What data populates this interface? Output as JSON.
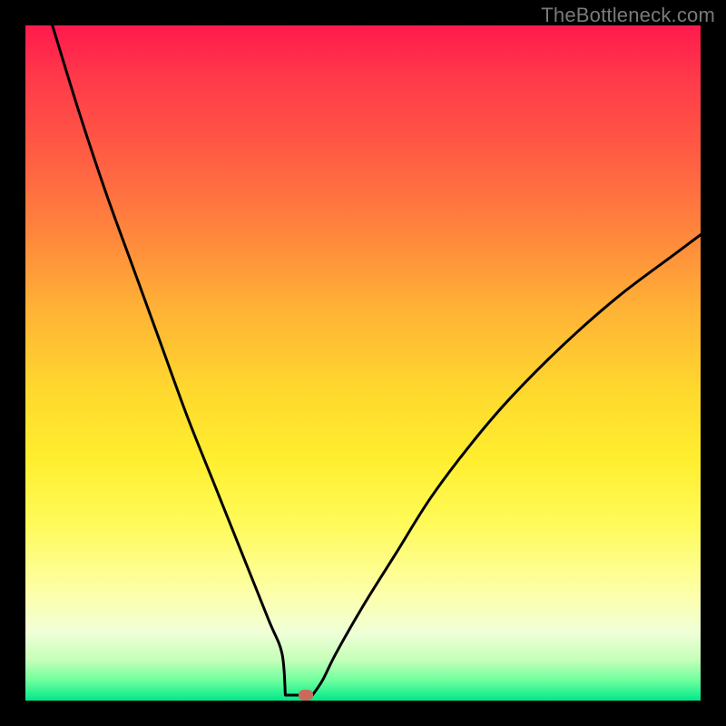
{
  "watermark": "TheBottleneck.com",
  "colors": {
    "frame": "#000000",
    "curve": "#000000",
    "marker": "#c96a5a",
    "gradient_stops": [
      "#ff1a4d",
      "#ff3a4a",
      "#ff5944",
      "#ff833d",
      "#ffb236",
      "#ffd82e",
      "#ffee2e",
      "#fffb5a",
      "#fdffa8",
      "#f0ffd8",
      "#c4ffb8",
      "#6fff9e",
      "#00e88a"
    ]
  },
  "chart_data": {
    "type": "line",
    "title": "",
    "xlabel": "",
    "ylabel": "",
    "xlim": [
      0,
      100
    ],
    "ylim": [
      0,
      100
    ],
    "grid": false,
    "legend": false,
    "series": [
      {
        "name": "bottleneck-curve",
        "x": [
          4,
          8,
          12,
          16,
          20,
          24,
          28,
          32,
          36,
          38,
          40,
          41,
          42,
          44,
          46,
          50,
          55,
          60,
          66,
          72,
          80,
          88,
          96,
          100
        ],
        "y": [
          100,
          87,
          75,
          64,
          53,
          42,
          32,
          22,
          12,
          7,
          3,
          1,
          1,
          3,
          7,
          14,
          22,
          30,
          38,
          45,
          53,
          60,
          66,
          69
        ]
      }
    ],
    "marker": {
      "x": 41.5,
      "y": 0.8
    },
    "flat_segment": {
      "x_start": 38.5,
      "x_end": 42.5,
      "y": 0.8
    }
  }
}
